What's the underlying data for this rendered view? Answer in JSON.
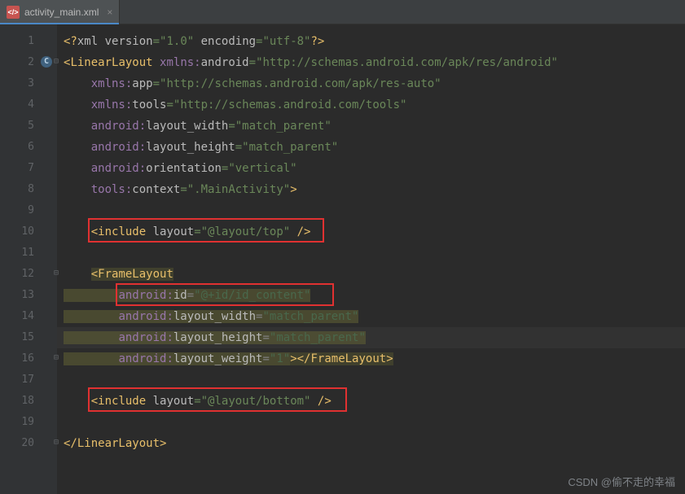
{
  "tabs": [
    {
      "label": "activity_main.xml",
      "icon": "</>",
      "active": true
    }
  ],
  "gutter": {
    "numbers": [
      "1",
      "2",
      "3",
      "4",
      "5",
      "6",
      "7",
      "8",
      "9",
      "10",
      "11",
      "12",
      "13",
      "14",
      "15",
      "16",
      "17",
      "18",
      "19",
      "20"
    ],
    "marker_line": 2,
    "marker_text": "C"
  },
  "code": {
    "l1": {
      "pi_open": "<?",
      "pi_name": "xml",
      "a1": " version",
      "eq": "=",
      "v1": "\"1.0\"",
      "a2": " encoding",
      "v2": "\"utf-8\"",
      "pi_close": "?>"
    },
    "l2": {
      "open": "<",
      "tag": "LinearLayout",
      "sp": " ",
      "ns": "xmlns:",
      "attr": "android",
      "eq": "=",
      "val": "\"http://schemas.android.com/apk/res/android\""
    },
    "l3": {
      "ns": "xmlns:",
      "attr": "app",
      "eq": "=",
      "val": "\"http://schemas.android.com/apk/res-auto\""
    },
    "l4": {
      "ns": "xmlns:",
      "attr": "tools",
      "eq": "=",
      "val": "\"http://schemas.android.com/tools\""
    },
    "l5": {
      "ns": "android:",
      "attr": "layout_width",
      "eq": "=",
      "val": "\"match_parent\""
    },
    "l6": {
      "ns": "android:",
      "attr": "layout_height",
      "eq": "=",
      "val": "\"match_parent\""
    },
    "l7": {
      "ns": "android:",
      "attr": "orientation",
      "eq": "=",
      "val": "\"vertical\""
    },
    "l8": {
      "ns": "tools:",
      "attr": "context",
      "eq": "=",
      "val": "\".MainActivity\"",
      "close": ">"
    },
    "l10": {
      "open": "<",
      "tag": "include",
      "sp": " ",
      "attr": "layout",
      "eq": "=",
      "val": "\"@layout/top\"",
      "close": " />"
    },
    "l12": {
      "open": "<",
      "tag": "FrameLayout"
    },
    "l13": {
      "ns": "android:",
      "attr": "id",
      "eq": "=",
      "val": "\"@+id/id_content\""
    },
    "l14": {
      "ns": "android:",
      "attr": "layout_width",
      "eq": "=",
      "val": "\"match_parent\""
    },
    "l15": {
      "ns": "android:",
      "attr": "layout_height",
      "eq": "=",
      "val": "\"match_parent\""
    },
    "l16": {
      "ns": "android:",
      "attr": "layout_weight",
      "eq": "=",
      "val": "\"1\"",
      "close1": ">",
      "close_open": "</",
      "close_tag": "FrameLayout",
      "close2": ">"
    },
    "l18": {
      "open": "<",
      "tag": "include",
      "sp": " ",
      "attr": "layout",
      "eq": "=",
      "val": "\"@layout/bottom\"",
      "close": " />"
    },
    "l20": {
      "open": "</",
      "tag": "LinearLayout",
      "close": ">"
    }
  },
  "indent": {
    "i1": "    ",
    "i2": "        ",
    "i3": "            "
  },
  "watermark": "CSDN @偷不走的幸福"
}
